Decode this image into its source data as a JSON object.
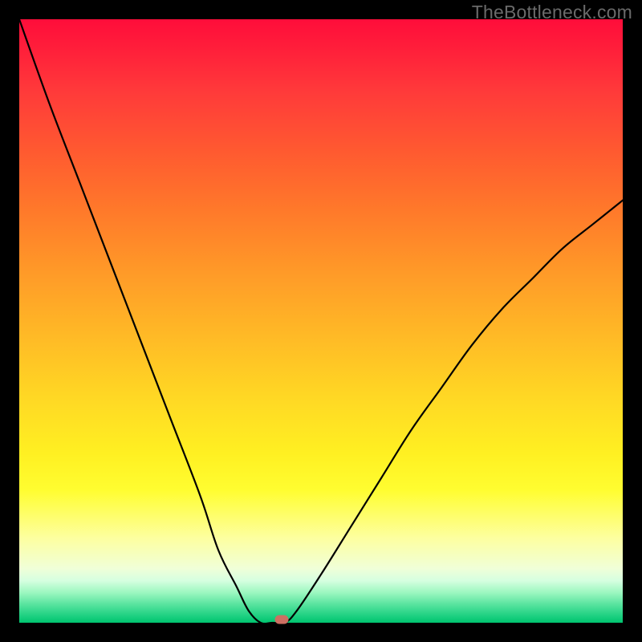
{
  "watermark": "TheBottleneck.com",
  "chart_data": {
    "type": "line",
    "title": "",
    "xlabel": "",
    "ylabel": "",
    "x": [
      0.0,
      0.05,
      0.1,
      0.15,
      0.2,
      0.25,
      0.3,
      0.33,
      0.36,
      0.38,
      0.4,
      0.42,
      0.44,
      0.46,
      0.5,
      0.55,
      0.6,
      0.65,
      0.7,
      0.75,
      0.8,
      0.85,
      0.9,
      0.95,
      1.0
    ],
    "values": [
      1.0,
      0.86,
      0.73,
      0.6,
      0.47,
      0.34,
      0.21,
      0.12,
      0.06,
      0.02,
      0.0,
      0.0,
      0.0,
      0.02,
      0.08,
      0.16,
      0.24,
      0.32,
      0.39,
      0.46,
      0.52,
      0.57,
      0.62,
      0.66,
      0.7
    ],
    "xlim": [
      0,
      1
    ],
    "ylim": [
      0,
      1
    ],
    "marker": {
      "x": 0.435,
      "y": 0.0
    },
    "gradient_stops": [
      {
        "pos": 0.0,
        "color": "#ff0d3a"
      },
      {
        "pos": 0.5,
        "color": "#ffb826"
      },
      {
        "pos": 0.78,
        "color": "#fffd30"
      },
      {
        "pos": 1.0,
        "color": "#00c46f"
      }
    ]
  }
}
